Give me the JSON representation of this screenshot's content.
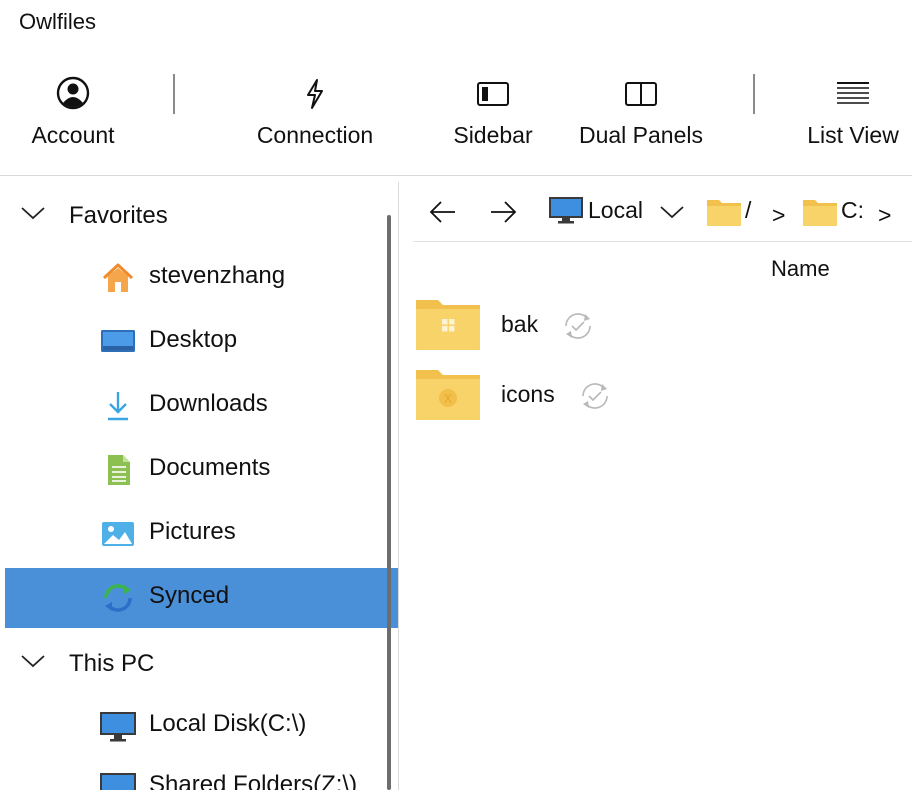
{
  "app": {
    "title": "Owlfiles"
  },
  "toolbar": {
    "account_label": "Account",
    "connection_label": "Connection",
    "sidebar_label": "Sidebar",
    "dual_panels_label": "Dual Panels",
    "list_view_label": "List View"
  },
  "sidebar": {
    "favorites": {
      "label": "Favorites",
      "items": [
        {
          "label": "stevenzhang",
          "icon": "home-icon"
        },
        {
          "label": "Desktop",
          "icon": "desktop-icon"
        },
        {
          "label": "Downloads",
          "icon": "download-icon"
        },
        {
          "label": "Documents",
          "icon": "document-icon"
        },
        {
          "label": "Pictures",
          "icon": "pictures-icon"
        },
        {
          "label": "Synced",
          "icon": "sync-icon",
          "selected": true
        }
      ]
    },
    "this_pc": {
      "label": "This PC",
      "items": [
        {
          "label": "Local Disk(C:\\)",
          "icon": "monitor-icon"
        },
        {
          "label": "Shared Folders(Z:\\)",
          "icon": "monitor-icon"
        }
      ]
    }
  },
  "nav": {
    "location_label": "Local",
    "breadcrumb_root": "/",
    "breadcrumb_sep": ">",
    "breadcrumb_drive": "C:"
  },
  "content": {
    "column_name": "Name",
    "files": [
      {
        "name": "bak",
        "type": "folder",
        "badge": "windows-logo"
      },
      {
        "name": "icons",
        "type": "folder",
        "badge": "x-badge"
      }
    ]
  },
  "colors": {
    "selection": "#4a90d9",
    "folder": "#f8d36a",
    "folder_dark": "#f2c04d"
  }
}
